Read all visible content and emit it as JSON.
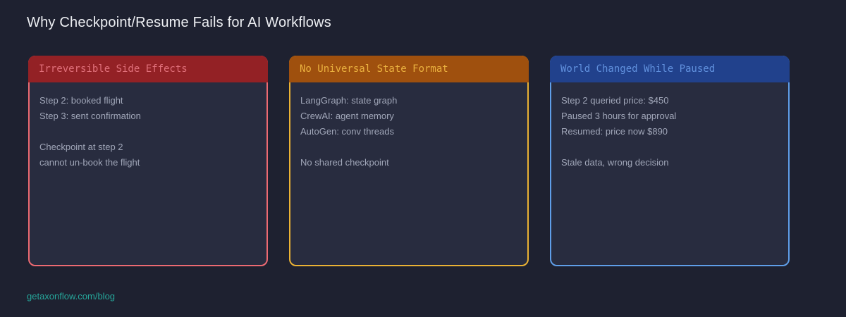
{
  "page": {
    "title": "Why Checkpoint/Resume Fails for AI Workflows",
    "footer_link": "getaxonflow.com/blog",
    "background": "#1e2130",
    "body_text_color": "#a0a6b8",
    "card_body_background": "#282c3f"
  },
  "cards": [
    {
      "title": "Irreversible Side Effects",
      "accent": "#ed6a72",
      "header_bg": "#932125",
      "header_text": "#e0707a",
      "lines": [
        "Step 2: booked flight",
        "Step 3: sent confirmation",
        "",
        "Checkpoint at step 2",
        "cannot un-book the flight"
      ]
    },
    {
      "title": "No Universal State Format",
      "accent": "#eab234",
      "header_bg": "#9f500e",
      "header_text": "#eab13f",
      "lines": [
        "LangGraph: state graph",
        "CrewAI: agent memory",
        "AutoGen: conv threads",
        "",
        "No shared checkpoint"
      ]
    },
    {
      "title": "World Changed While Paused",
      "accent": "#5f9ee8",
      "header_bg": "#21418c",
      "header_text": "#6090dd",
      "lines": [
        "Step 2 queried price: $450",
        "Paused 3 hours for approval",
        "Resumed: price now $890",
        "",
        "Stale data, wrong decision"
      ]
    }
  ]
}
